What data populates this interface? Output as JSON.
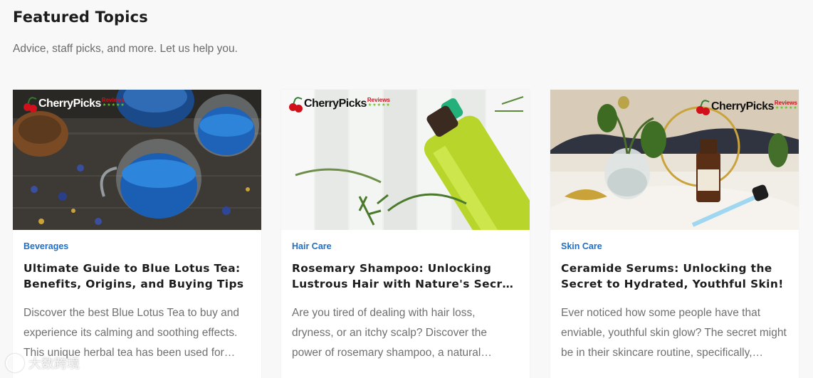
{
  "section": {
    "title": "Featured Topics",
    "subtitle": "Advice, staff picks, and more. Let us help you."
  },
  "logo": {
    "text": "CherryPicks",
    "reviews": "Reviews",
    "stars": "★★★★★"
  },
  "cards": [
    {
      "category": "Beverages",
      "title": "Ultimate Guide to Blue Lotus Tea: Benefits, Origins, and Buying Tips",
      "excerpt": "Discover the best Blue Lotus Tea to buy and experience its calming and soothing effects. This unique herbal tea has been used for centuries in ancient cultures."
    },
    {
      "category": "Hair Care",
      "title": "Rosemary Shampoo: Unlocking Lustrous Hair with Nature's Secret Ingredient",
      "excerpt": "Are you tired of dealing with hair loss, dryness, or an itchy scalp? Discover the power of rosemary shampoo, a natural solution that works wonders."
    },
    {
      "category": "Skin Care",
      "title": "Ceramide Serums: Unlocking the Secret to Hydrated, Youthful Skin!",
      "excerpt": "Ever noticed how some people have that enviable, youthful skin glow? The secret might be in their skincare routine, specifically, ceramide serums."
    }
  ],
  "watermark": {
    "text": "大数跨境"
  },
  "colors": {
    "category_link": "#1f6fc5",
    "logo_red": "#d0101a",
    "page_bg": "#f8f8f8"
  }
}
